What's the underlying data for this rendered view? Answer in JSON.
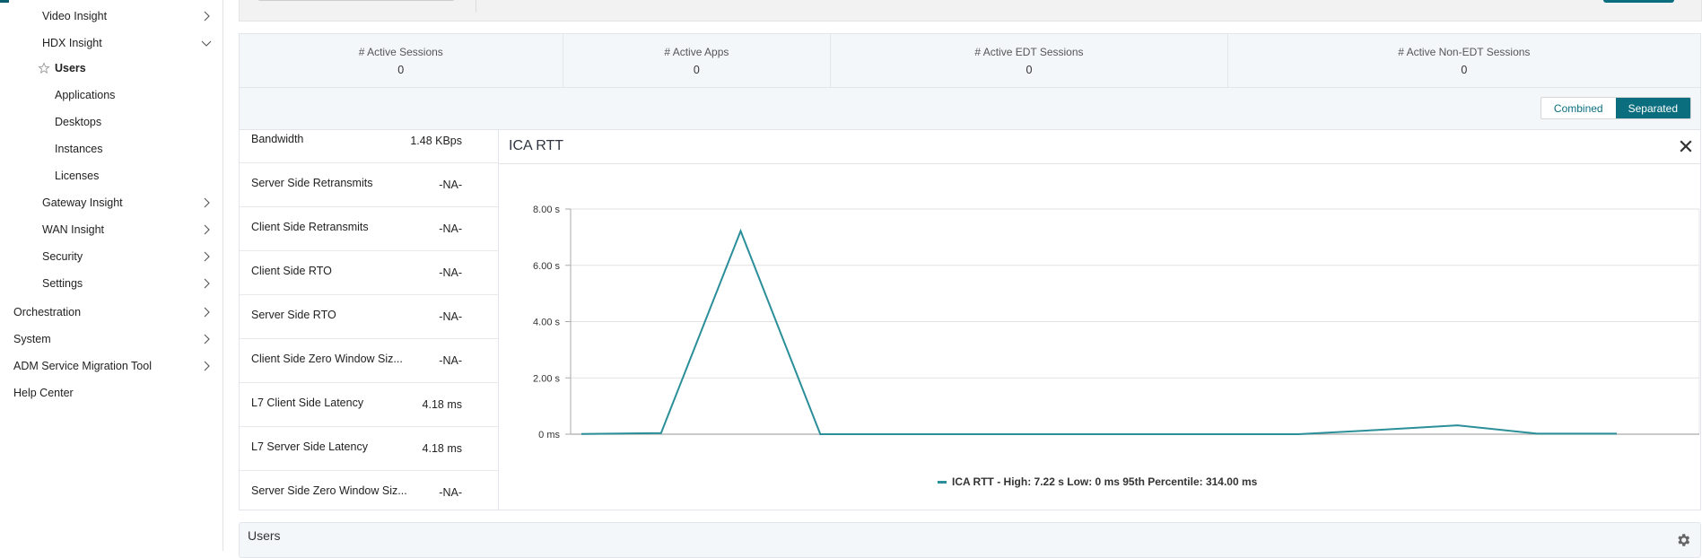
{
  "sidebar": {
    "items": [
      {
        "label": "Video Insight",
        "level": 2,
        "chevron": "right"
      },
      {
        "label": "HDX Insight",
        "level": 2,
        "chevron": "down"
      },
      {
        "label": "Users",
        "level": 3,
        "active": true,
        "icon": "star-icon"
      },
      {
        "label": "Applications",
        "level": 3
      },
      {
        "label": "Desktops",
        "level": 3
      },
      {
        "label": "Instances",
        "level": 3
      },
      {
        "label": "Licenses",
        "level": 3
      },
      {
        "label": "Gateway Insight",
        "level": 2,
        "chevron": "right"
      },
      {
        "label": "WAN Insight",
        "level": 2,
        "chevron": "right"
      },
      {
        "label": "Security",
        "level": 2,
        "chevron": "right"
      },
      {
        "label": "Settings",
        "level": 2,
        "chevron": "right"
      },
      {
        "label": "Orchestration",
        "level": 1,
        "chevron": "right"
      },
      {
        "label": "System",
        "level": 1,
        "chevron": "right"
      },
      {
        "label": "ADM Service Migration Tool",
        "level": 1,
        "chevron": "right"
      },
      {
        "label": "Help Center",
        "level": 1
      }
    ]
  },
  "stats": [
    {
      "label": "# Active Sessions",
      "value": "0"
    },
    {
      "label": "# Active Apps",
      "value": "0"
    },
    {
      "label": "# Active EDT Sessions",
      "value": "0"
    },
    {
      "label": "# Active Non-EDT Sessions",
      "value": "0"
    }
  ],
  "view_toggle": {
    "combined": "Combined",
    "separated": "Separated",
    "selected": "Separated"
  },
  "metrics": [
    {
      "label": "Bandwidth",
      "value": "1.48 KBps"
    },
    {
      "label": "Server Side Retransmits",
      "value": "-NA-"
    },
    {
      "label": "Client Side Retransmits",
      "value": "-NA-"
    },
    {
      "label": "Client Side RTO",
      "value": "-NA-"
    },
    {
      "label": "Server Side RTO",
      "value": "-NA-"
    },
    {
      "label": "Client Side Zero Window Siz...",
      "value": "-NA-"
    },
    {
      "label": "L7 Client Side Latency",
      "value": "4.18 ms"
    },
    {
      "label": "L7 Server Side Latency",
      "value": "4.18 ms"
    },
    {
      "label": "Server Side Zero Window Siz...",
      "value": "-NA-"
    }
  ],
  "chart_panel": {
    "title": "ICA RTT",
    "close_icon": "close-icon"
  },
  "chart_data": {
    "type": "line",
    "title": "ICA RTT",
    "xlabel": "",
    "ylabel": "",
    "y_unit": "s",
    "ylim": [
      0,
      8
    ],
    "y_ticks": [
      0,
      2,
      4,
      6,
      8
    ],
    "y_tick_labels": [
      "0 ms",
      "2.00 s",
      "4.00 s",
      "6.00 s",
      "8.00 s"
    ],
    "grid": true,
    "legend_position": "bottom",
    "series": [
      {
        "name": "ICA RTT",
        "color": "#2a8f99",
        "values": [
          0.01,
          0.04,
          7.22,
          0,
          0,
          0,
          0,
          0,
          0,
          0,
          0.15,
          0.314,
          0.02,
          0.02
        ]
      }
    ],
    "legend_text": "ICA RTT - High: 7.22 s Low: 0 ms 95th Percentile: 314.00 ms"
  },
  "users_panel": {
    "title": "Users",
    "gear_icon": "gear-icon"
  },
  "colors": {
    "accent": "#0b6e7e",
    "line": "#2a8f99"
  }
}
